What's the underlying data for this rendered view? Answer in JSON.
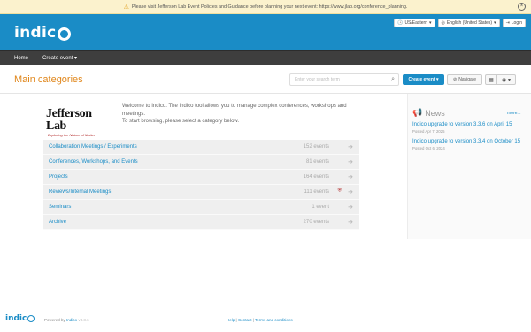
{
  "banner": {
    "text": "Please visit Jefferson Lab Event Policies and Guidance before planning your next event: https://www.jlab.org/conference_planning."
  },
  "header": {
    "logo_text": "indico",
    "timezone": "US/Eastern",
    "language": "English (United States)",
    "login": "Login"
  },
  "nav": {
    "home": "Home",
    "create_event": "Create event"
  },
  "main": {
    "title": "Main categories",
    "search_placeholder": "Enter your search term",
    "create_event_btn": "Create event",
    "navigate_btn": "Navigate"
  },
  "jlab": {
    "name": "Jefferson Lab",
    "tagline": "Exploring the Nature of Matter"
  },
  "welcome": {
    "line1": "Welcome to Indico. The Indico tool allows you to manage complex conferences, workshops and meetings.",
    "line2": "To start browsing, please select a category below."
  },
  "categories": [
    {
      "name": "Collaboration Meetings / Experiments",
      "count": "152 events"
    },
    {
      "name": "Conferences, Workshops, and Events",
      "count": "81 events"
    },
    {
      "name": "Projects",
      "count": "164 events"
    },
    {
      "name": "Reviews/Internal Meetings",
      "count": "111 events"
    },
    {
      "name": "Seminars",
      "count": "1 event"
    },
    {
      "name": "Archive",
      "count": "270 events"
    }
  ],
  "news": {
    "heading": "News",
    "more": "more...",
    "items": [
      {
        "title": "Indico upgrade to version 3.3.6 on April 15",
        "date": "Posted Apr 7, 2025"
      },
      {
        "title": "Indico upgrade to version 3.3.4 on October 15",
        "date": "Posted Oct 6, 2024"
      }
    ]
  },
  "footer": {
    "logo_text": "indico",
    "powered_by": "Powered by",
    "indico_link": "Indico",
    "version": "v3.3.6",
    "help": "Help",
    "sep1": " | ",
    "contact": "Contact",
    "sep2": " | ",
    "terms": "Terms and conditions"
  }
}
